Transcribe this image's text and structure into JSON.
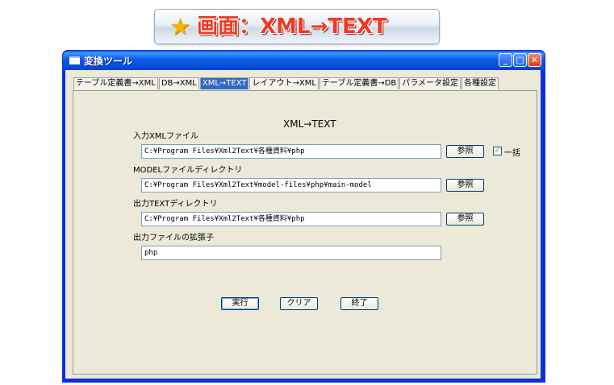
{
  "banner": {
    "star": "★",
    "text": "画面：XML→TEXT"
  },
  "window": {
    "title": "変換ツール",
    "controls": {
      "minimize": "_",
      "maximize": "□",
      "close": "✕"
    }
  },
  "tabs": [
    {
      "label": "テーブル定義書→XML",
      "active": false
    },
    {
      "label": "DB→XML",
      "active": false
    },
    {
      "label": "XML→TEXT",
      "active": true
    },
    {
      "label": "レイアウト→XML",
      "active": false
    },
    {
      "label": "テーブル定義書→DB",
      "active": false
    },
    {
      "label": "パラメータ設定",
      "active": false
    },
    {
      "label": "各種設定",
      "active": false
    }
  ],
  "form": {
    "heading": "XML→TEXT",
    "input_xml": {
      "label": "入力XMLファイル",
      "value": "C:¥Program Files¥Xml2Text¥各種資料¥php",
      "browse": "参照"
    },
    "bulk": {
      "label": "一括",
      "checked": true,
      "mark": "✓"
    },
    "model_dir": {
      "label": "MODELファイルディレクトリ",
      "value": "C:¥Program Files¥Xml2Text¥model-files¥php¥main-model",
      "browse": "参照"
    },
    "output_dir": {
      "label": "出力TEXTディレクトリ",
      "value": "C:¥Program Files¥Xml2Text¥各種資料¥php",
      "browse": "参照"
    },
    "extension": {
      "label": "出力ファイルの拡張子",
      "value": "php"
    }
  },
  "actions": {
    "run": "実行",
    "clear": "クリア",
    "exit": "終了"
  }
}
